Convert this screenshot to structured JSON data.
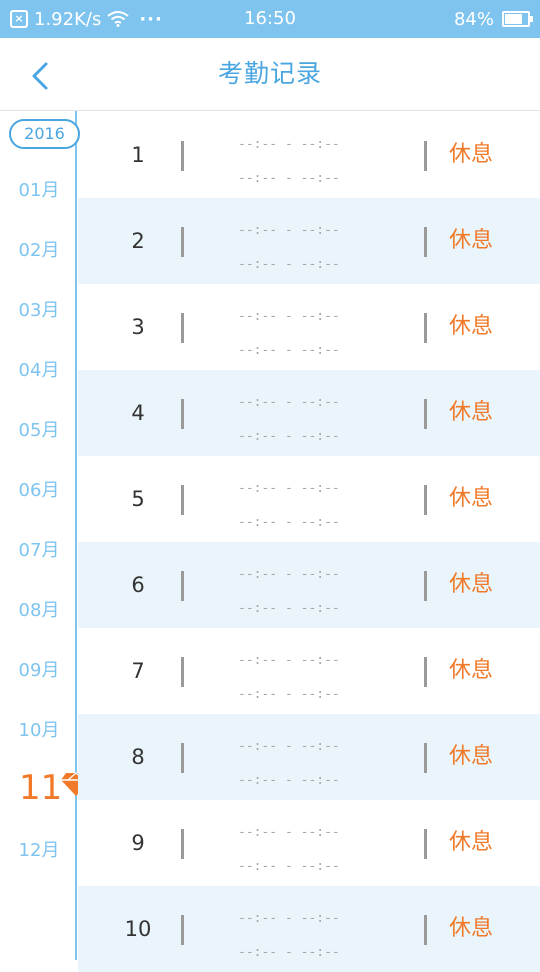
{
  "status_bar": {
    "speed": "1.92K/s",
    "dots": "···",
    "time": "16:50",
    "battery": "84%",
    "battery_level": 0.84
  },
  "header": {
    "title": "考勤记录",
    "back_icon": "chevron-left-icon"
  },
  "sidebar": {
    "year": "2016",
    "months": [
      "01月",
      "02月",
      "03月",
      "04月",
      "05月",
      "06月",
      "07月",
      "08月",
      "09月",
      "10月",
      "11",
      "12月"
    ],
    "current_month": "11",
    "current_icon": "gem-icon"
  },
  "records": [
    {
      "day": "1",
      "morning": "--:-- - --:--",
      "evening": "--:-- - --:--",
      "status": "休息"
    },
    {
      "day": "2",
      "morning": "--:-- - --:--",
      "evening": "--:-- - --:--",
      "status": "休息"
    },
    {
      "day": "3",
      "morning": "--:-- - --:--",
      "evening": "--:-- - --:--",
      "status": "休息"
    },
    {
      "day": "4",
      "morning": "--:-- - --:--",
      "evening": "--:-- - --:--",
      "status": "休息"
    },
    {
      "day": "5",
      "morning": "--:-- - --:--",
      "evening": "--:-- - --:--",
      "status": "休息"
    },
    {
      "day": "6",
      "morning": "--:-- - --:--",
      "evening": "--:-- - --:--",
      "status": "休息"
    },
    {
      "day": "7",
      "morning": "--:-- - --:--",
      "evening": "--:-- - --:--",
      "status": "休息"
    },
    {
      "day": "8",
      "morning": "--:-- - --:--",
      "evening": "--:-- - --:--",
      "status": "休息"
    },
    {
      "day": "9",
      "morning": "--:-- - --:--",
      "evening": "--:-- - --:--",
      "status": "休息"
    },
    {
      "day": "10",
      "morning": "--:-- - --:--",
      "evening": "--:-- - --:--",
      "status": "休息"
    }
  ],
  "colors": {
    "accent": "#4aa6e0",
    "status_bar": "#7ec4ef",
    "highlight": "#f07a2a",
    "row_alt": "#e9f5fb"
  }
}
